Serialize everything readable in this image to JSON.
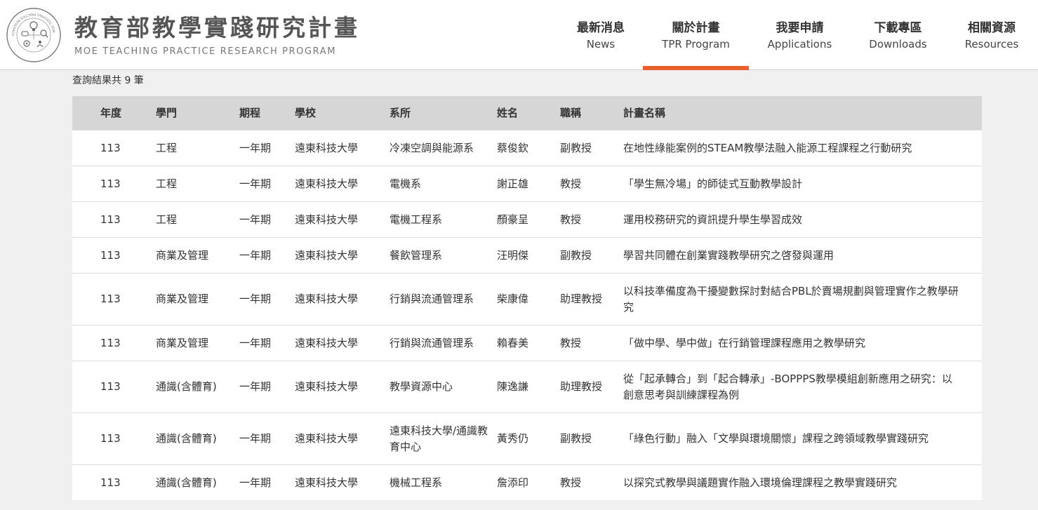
{
  "header": {
    "logo_title": "教育部教學實踐研究計畫",
    "logo_subtitle": "MOE TEACHING PRACTICE RESEARCH PROGRAM",
    "logo_ring_text": "MOE TEACHING PRACTICE RESEARCH PROGRAM",
    "accent_color": "#e8602c"
  },
  "nav": [
    {
      "zh": "最新消息",
      "en": "News",
      "active": false
    },
    {
      "zh": "關於計畫",
      "en": "TPR Program",
      "active": true
    },
    {
      "zh": "我要申請",
      "en": "Applications",
      "active": false
    },
    {
      "zh": "下載專區",
      "en": "Downloads",
      "active": false
    },
    {
      "zh": "相關資源",
      "en": "Resources",
      "active": false
    }
  ],
  "result_count": "查詢結果共 9 筆",
  "table": {
    "headers": [
      "年度",
      "學門",
      "期程",
      "學校",
      "系所",
      "姓名",
      "職稱",
      "計畫名稱"
    ],
    "rows": [
      [
        "113",
        "工程",
        "一年期",
        "遠東科技大學",
        "冷凍空調與能源系",
        "蔡俊欽",
        "副教授",
        "在地性綠能案例的STEAM教學法融入能源工程課程之行動研究"
      ],
      [
        "113",
        "工程",
        "一年期",
        "遠東科技大學",
        "電機系",
        "謝正雄",
        "教授",
        "「學生無冷場」的師徒式互動教學設計"
      ],
      [
        "113",
        "工程",
        "一年期",
        "遠東科技大學",
        "電機工程系",
        "顏豪呈",
        "教授",
        "運用校務研究的資訊提升學生學習成效"
      ],
      [
        "113",
        "商業及管理",
        "一年期",
        "遠東科技大學",
        "餐飲管理系",
        "汪明傑",
        "副教授",
        "學習共同體在創業實踐教學研究之啓發與運用"
      ],
      [
        "113",
        "商業及管理",
        "一年期",
        "遠東科技大學",
        "行銷與流通管理系",
        "柴康偉",
        "助理教授",
        "以科技準備度為干擾變數探討對結合PBL於賣場規劃與管理實作之教學研究"
      ],
      [
        "113",
        "商業及管理",
        "一年期",
        "遠東科技大學",
        "行銷與流通管理系",
        "賴春美",
        "教授",
        "「做中學、學中做」在行銷管理課程應用之教學研究"
      ],
      [
        "113",
        "通識(含體育)",
        "一年期",
        "遠東科技大學",
        "教學資源中心",
        "陳逸謙",
        "助理教授",
        "從「起承轉合」到「起合轉承」-BOPPPS教學模組創新應用之研究：以創意思考與訓練課程為例"
      ],
      [
        "113",
        "通識(含體育)",
        "一年期",
        "遠東科技大學",
        "遠東科技大學/通識教育中心",
        "黃秀仍",
        "副教授",
        "「綠色行動」融入「文學與環境關懷」課程之跨領域教學實踐研究"
      ],
      [
        "113",
        "通識(含體育)",
        "一年期",
        "遠東科技大學",
        "機械工程系",
        "詹添印",
        "教授",
        "以探究式教學與議題實作融入環境倫理課程之教學實踐研究"
      ]
    ]
  }
}
